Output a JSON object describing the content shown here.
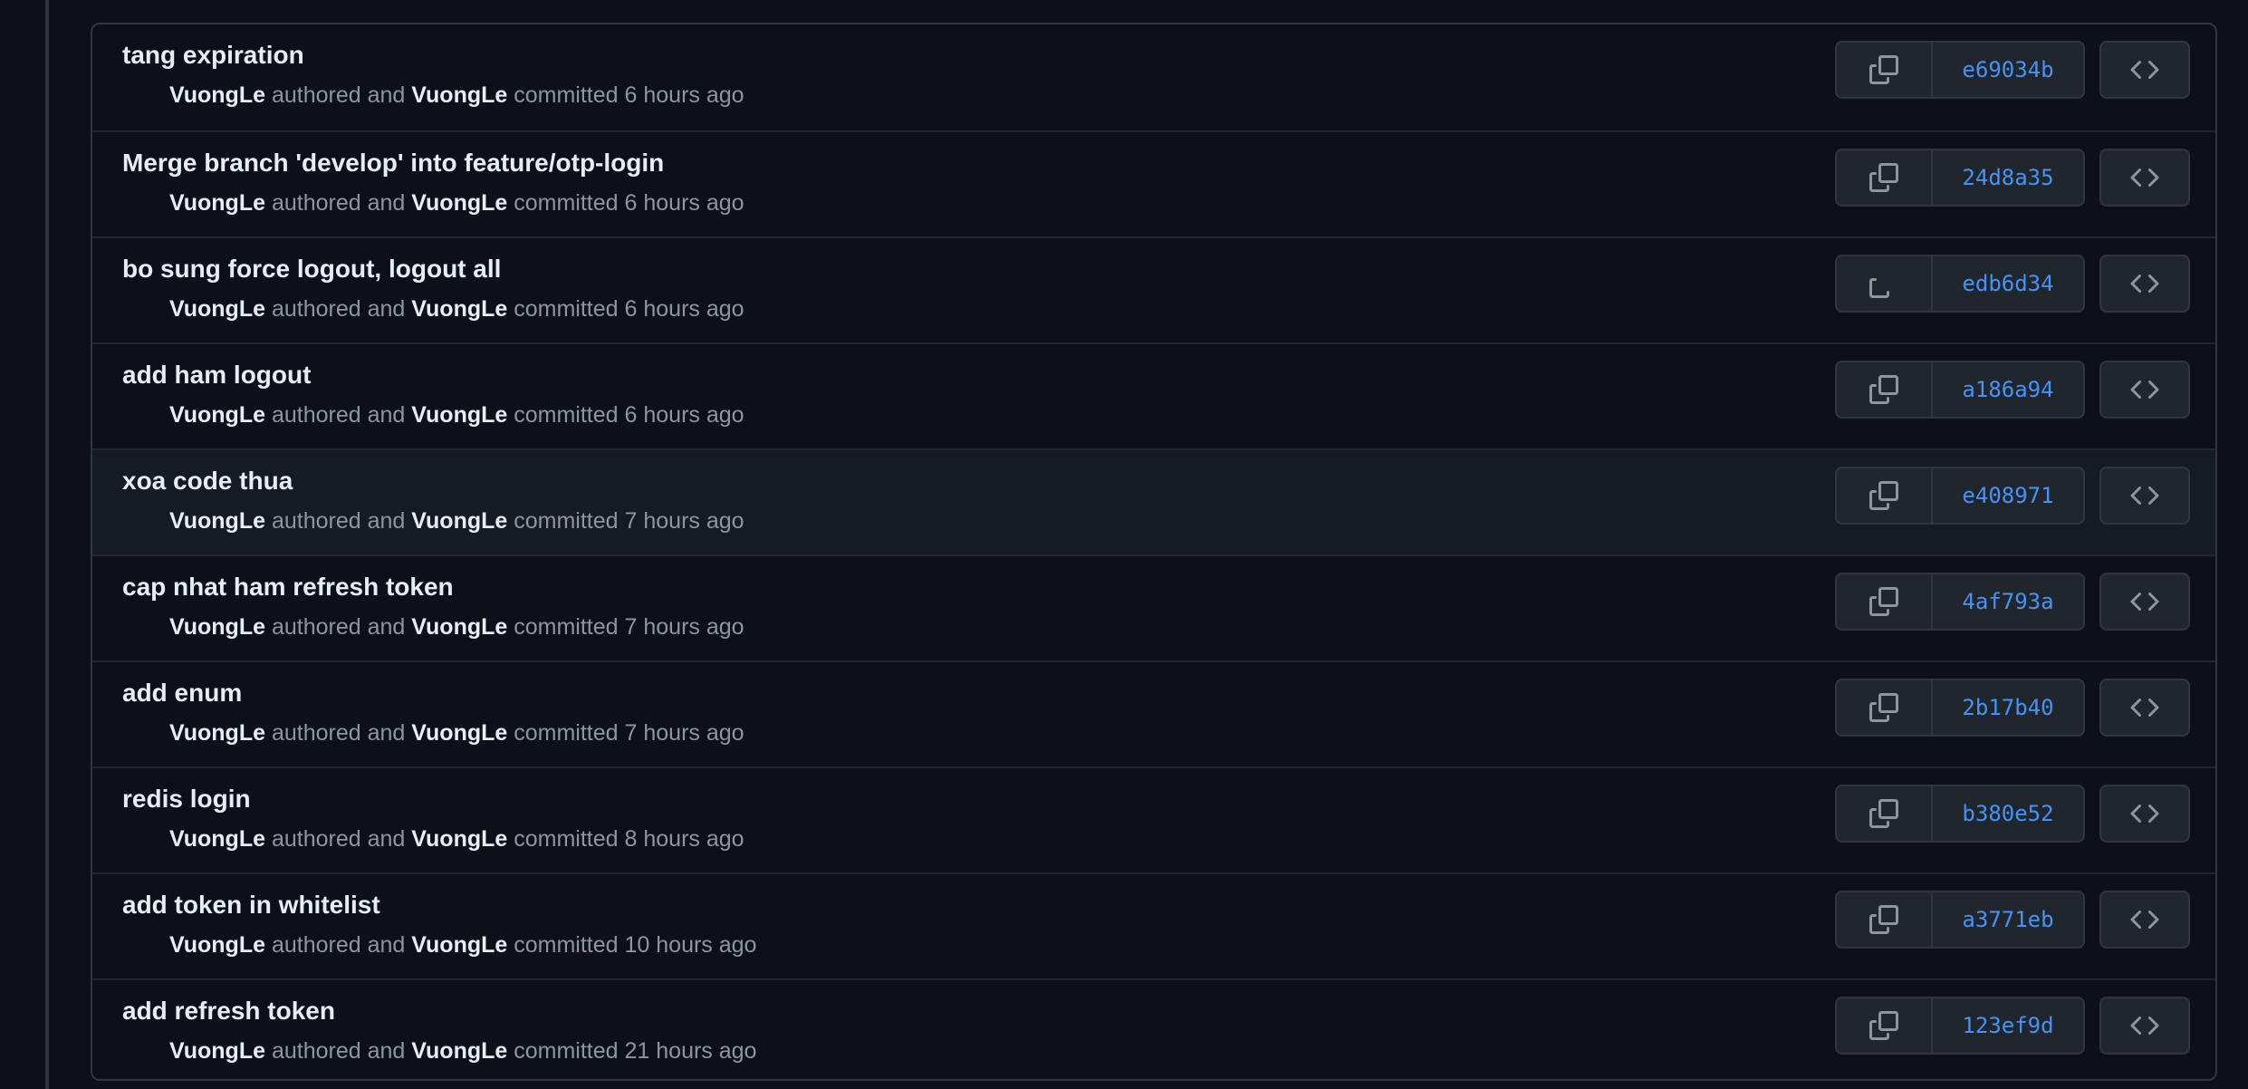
{
  "commits": [
    {
      "title": "tang expiration",
      "author": "VuongLe",
      "authored_text": "authored and",
      "committer": "VuongLe",
      "committed_text": "committed 6 hours ago",
      "sha": "e69034b"
    },
    {
      "title": "Merge branch 'develop' into feature/otp-login",
      "author": "VuongLe",
      "authored_text": "authored and",
      "committer": "VuongLe",
      "committed_text": "committed 6 hours ago",
      "sha": "24d8a35"
    },
    {
      "title": "bo sung force logout, logout all",
      "author": "VuongLe",
      "authored_text": "authored and",
      "committer": "VuongLe",
      "committed_text": "committed 6 hours ago",
      "sha": "edb6d34"
    },
    {
      "title": "add ham logout",
      "author": "VuongLe",
      "authored_text": "authored and",
      "committer": "VuongLe",
      "committed_text": "committed 6 hours ago",
      "sha": "a186a94"
    },
    {
      "title": "xoa code thua",
      "author": "VuongLe",
      "authored_text": "authored and",
      "committer": "VuongLe",
      "committed_text": "committed 7 hours ago",
      "sha": "e408971"
    },
    {
      "title": "cap nhat ham refresh token",
      "author": "VuongLe",
      "authored_text": "authored and",
      "committer": "VuongLe",
      "committed_text": "committed 7 hours ago",
      "sha": "4af793a"
    },
    {
      "title": "add enum",
      "author": "VuongLe",
      "authored_text": "authored and",
      "committer": "VuongLe",
      "committed_text": "committed 7 hours ago",
      "sha": "2b17b40"
    },
    {
      "title": "redis login",
      "author": "VuongLe",
      "authored_text": "authored and",
      "committer": "VuongLe",
      "committed_text": "committed 8 hours ago",
      "sha": "b380e52"
    },
    {
      "title": "add token in whitelist",
      "author": "VuongLe",
      "authored_text": "authored and",
      "committer": "VuongLe",
      "committed_text": "committed 10 hours ago",
      "sha": "a3771eb"
    },
    {
      "title": "add refresh token",
      "author": "VuongLe",
      "authored_text": "authored and",
      "committer": "VuongLe",
      "committed_text": "committed 21 hours ago",
      "sha": "123ef9d"
    }
  ],
  "icons": {
    "copy": "copy-icon",
    "browse": "code-icon"
  },
  "colors": {
    "background": "#0d1117",
    "border": "#30363d",
    "sha_link": "#4493f8",
    "title_text": "#e6edf3",
    "muted_text": "#8d96a0"
  }
}
